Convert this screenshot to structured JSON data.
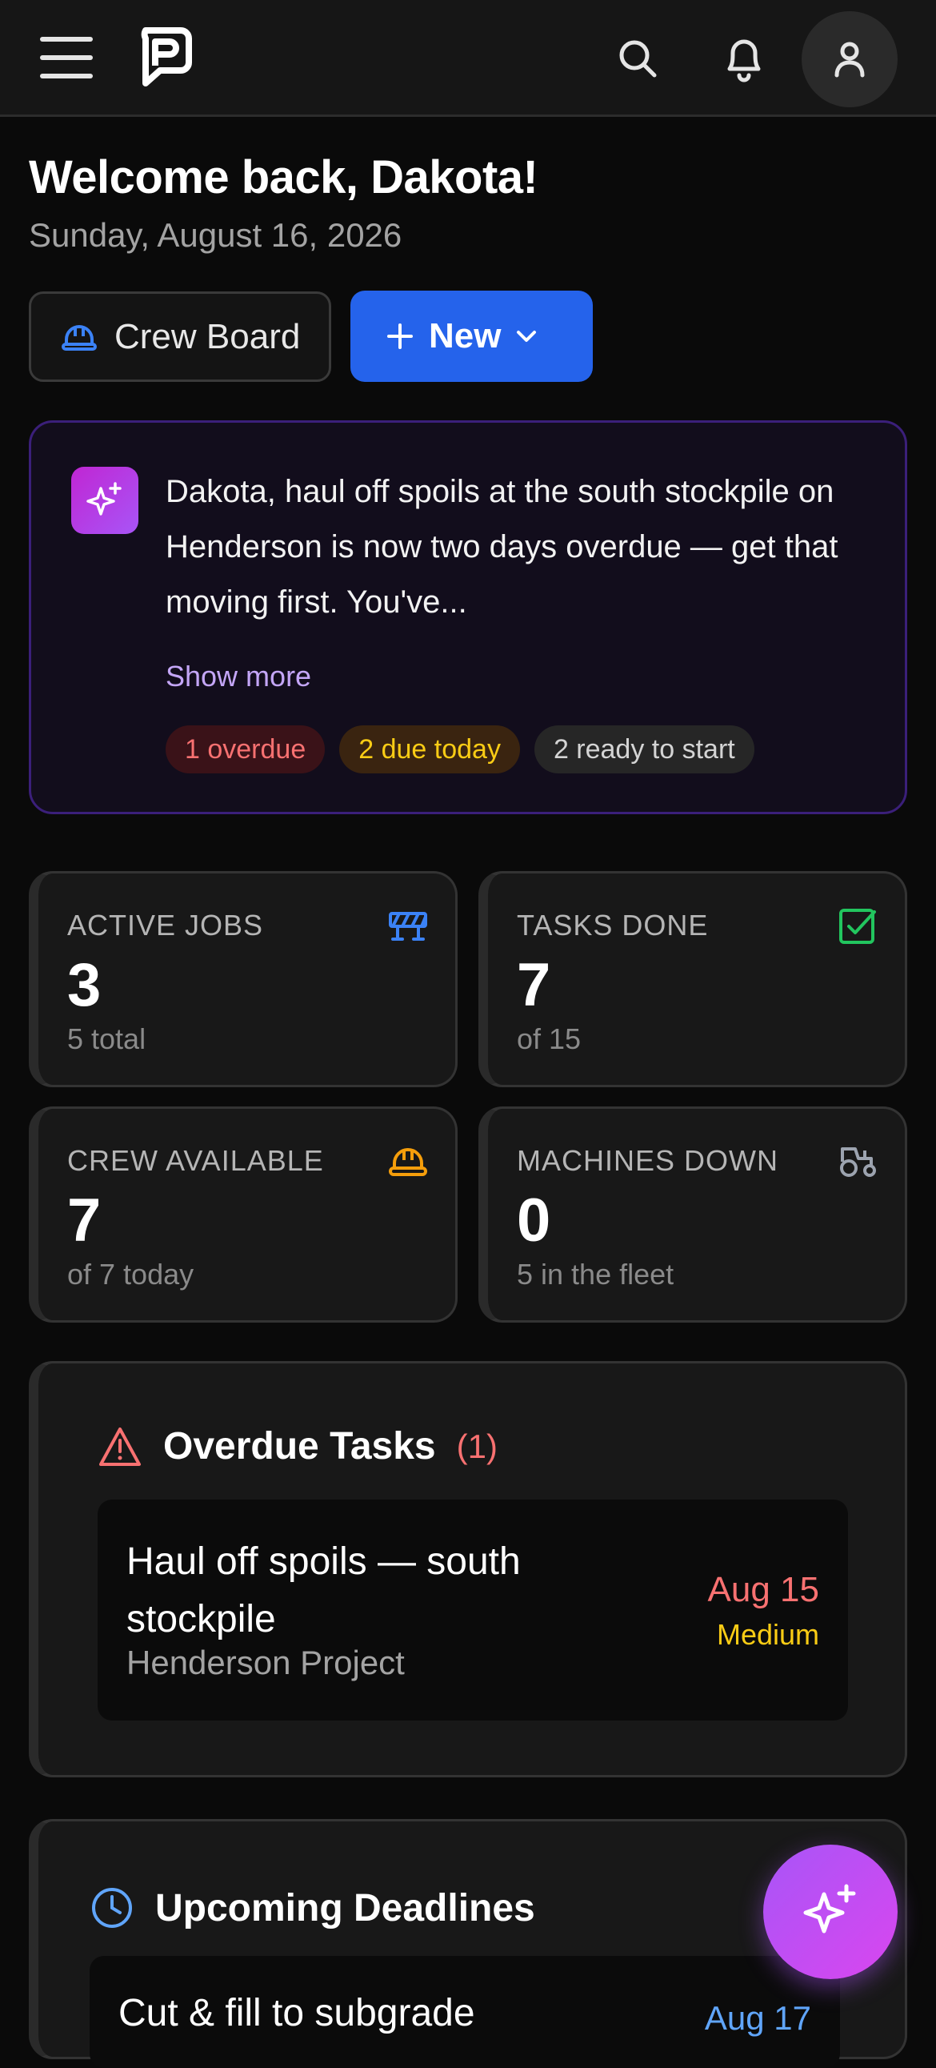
{
  "header": {
    "avatar_alt": ""
  },
  "welcome": {
    "title": "Welcome back, Dakota!",
    "date": "Sunday, August 16, 2026"
  },
  "actions": {
    "crew_board_label": "Crew Board",
    "new_label": "New"
  },
  "ai_summary": {
    "text": "Dakota, haul off spoils at the south stockpile on Henderson is now two days overdue — get that moving first. You've...",
    "show_more_label": "Show more",
    "chips": {
      "overdue": "1 overdue",
      "due_today": "2 due today",
      "ready": "2 ready to start"
    }
  },
  "stats": [
    {
      "label": "ACTIVE JOBS",
      "value": "3",
      "sub": "5 total",
      "icon": "barrier-icon",
      "icon_color": "#3b82f6"
    },
    {
      "label": "TASKS DONE",
      "value": "7",
      "sub": "of 15",
      "icon": "checkbox-icon",
      "icon_color": "#22c55e"
    },
    {
      "label": "CREW AVAILABLE",
      "value": "7",
      "sub": "of 7 today",
      "icon": "hardhat-icon",
      "icon_color": "#f59e0b"
    },
    {
      "label": "MACHINES DOWN",
      "value": "0",
      "sub": "5 in the fleet",
      "icon": "tractor-icon",
      "icon_color": "#9ca3af"
    }
  ],
  "overdue": {
    "title": "Overdue Tasks",
    "count": "(1)",
    "tasks": [
      {
        "title": "Haul off spoils — south stockpile",
        "project": "Henderson Project",
        "date": "Aug 15",
        "priority": "Medium"
      }
    ]
  },
  "upcoming": {
    "title": "Upcoming Deadlines",
    "items": [
      {
        "title": "Cut & fill to subgrade",
        "date": "Aug 17"
      }
    ]
  },
  "colors": {
    "accent": "#2563eb",
    "danger": "#f87171",
    "warning": "#facc15",
    "ai_purple": "#a855f7"
  }
}
